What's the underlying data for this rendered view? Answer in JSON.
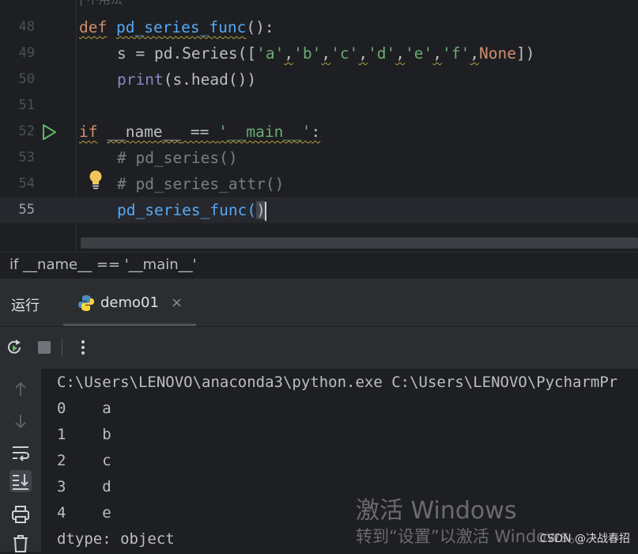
{
  "editor": {
    "top_partial_text": "| 不用法",
    "lines": [
      {
        "num": "48"
      },
      {
        "num": "49"
      },
      {
        "num": "50"
      },
      {
        "num": "51"
      },
      {
        "num": "52"
      },
      {
        "num": "53"
      },
      {
        "num": "54"
      },
      {
        "num": "55"
      }
    ],
    "code": {
      "l48_def": "def",
      "l48_name": "pd_series_func",
      "l48_tail": "():",
      "l49_pre": "s = pd.Series([",
      "l49_a": "'a'",
      "l49_b": "'b'",
      "l49_c": "'c'",
      "l49_d": "'d'",
      "l49_e": "'e'",
      "l49_f": "'f'",
      "l49_none": "None",
      "l49_end": "])",
      "l50_print": "print",
      "l50_rest": "(s.head())",
      "l52_if": "if",
      "l52_name": "__name__",
      "l52_eq": " == ",
      "l52_main": "'__main__'",
      "l52_colon": ":",
      "l53": "# pd_series()",
      "l54": "# pd_series_attr()",
      "l55_call": "pd_series_func(",
      "l55_close": ")"
    }
  },
  "breadcrumb": "if __name__ == '__main__'",
  "run_panel": {
    "title": "运行",
    "tab_label": "demo01",
    "tab_close": "×"
  },
  "console": {
    "command": "C:\\Users\\LENOVO\\anaconda3\\python.exe C:\\Users\\LENOVO\\PycharmPr",
    "rows": [
      {
        "index": "0",
        "value": "a"
      },
      {
        "index": "1",
        "value": "b"
      },
      {
        "index": "2",
        "value": "c"
      },
      {
        "index": "3",
        "value": "d"
      },
      {
        "index": "4",
        "value": "e"
      }
    ],
    "dtype": "dtype: object"
  },
  "watermark": {
    "line1": "激活 Windows",
    "line2": "转到“设置”以激活 Windows。",
    "csdn": "CSDN @决战春招"
  },
  "icons": [
    "run-gutter-icon",
    "bulb-icon",
    "python-icon",
    "rerun-icon",
    "stop-icon",
    "more-icon",
    "scroll-up-icon",
    "scroll-down-icon",
    "soft-wrap-icon",
    "scroll-to-end-icon",
    "print-icon",
    "trash-icon"
  ],
  "colors": {
    "editor_bg": "#1e1f22",
    "panel_bg": "#2b2d30",
    "keyword": "#cf8e6d",
    "function": "#56a8f5",
    "string": "#6aab73",
    "comment": "#7a7e85"
  }
}
